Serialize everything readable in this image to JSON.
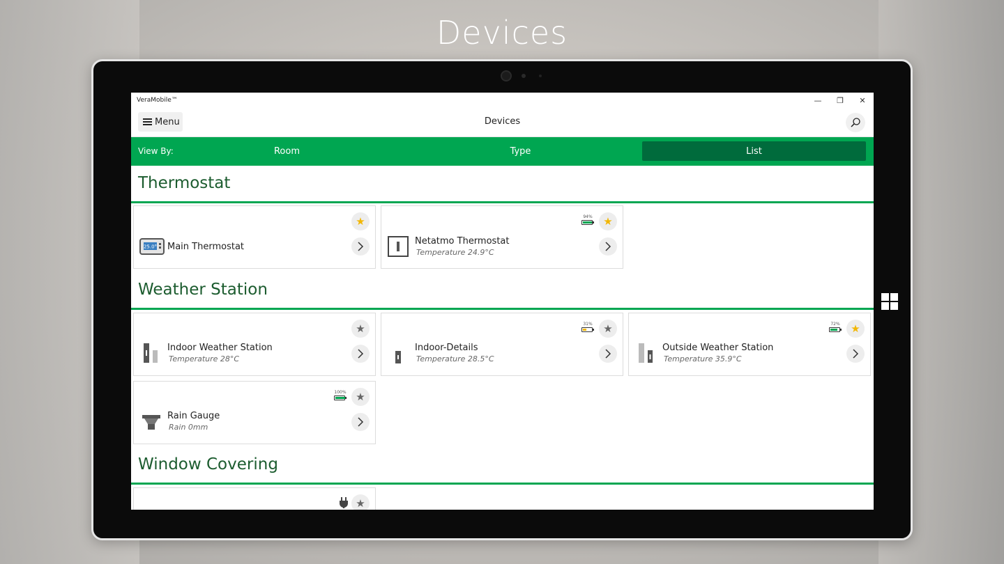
{
  "page_heading": "Devices",
  "window": {
    "title": "VeraMobile™",
    "minimize_glyph": "—",
    "restore_glyph": "❐",
    "close_glyph": "✕"
  },
  "appbar": {
    "menu_label": "Menu",
    "title": "Devices"
  },
  "view_by": {
    "label": "View By:",
    "tabs": [
      {
        "label": "Room",
        "active": false
      },
      {
        "label": "Type",
        "active": false
      },
      {
        "label": "List",
        "active": true
      }
    ]
  },
  "sections": [
    {
      "title": "Thermostat",
      "devices": [
        {
          "name": "Main Thermostat",
          "detail": "",
          "icon": "thermostat-display-icon",
          "display_value": "25.0°",
          "favorite": true,
          "battery": null
        },
        {
          "name": "Netatmo Thermostat",
          "detail": "Temperature 24.9°C",
          "icon": "thermostat-box-icon",
          "favorite": true,
          "battery": {
            "percent": 94,
            "label": "94%"
          }
        }
      ]
    },
    {
      "title": "Weather Station",
      "devices": [
        {
          "name": "Indoor Weather Station",
          "detail": "Temperature 28°C",
          "icon": "weather-station-icon",
          "favorite": false,
          "battery": null
        },
        {
          "name": "Indoor-Details",
          "detail": "Temperature 28.5°C",
          "icon": "weather-module-icon",
          "favorite": false,
          "battery": {
            "percent": 31,
            "label": "31%"
          }
        },
        {
          "name": "Outside Weather Station",
          "detail": "Temperature 35.9°C",
          "icon": "weather-station-icon",
          "favorite": true,
          "battery": {
            "percent": 72,
            "label": "72%"
          }
        },
        {
          "name": "Rain Gauge",
          "detail": "Rain 0mm",
          "icon": "rain-gauge-icon",
          "favorite": false,
          "battery": {
            "percent": 100,
            "label": "100%"
          }
        }
      ]
    },
    {
      "title": "Window Covering",
      "devices": [
        {
          "name": "",
          "detail": "",
          "icon": "",
          "favorite": false,
          "battery": null,
          "powered": true
        }
      ]
    }
  ],
  "colors": {
    "accent_green": "#00a651",
    "active_tab": "#006b3c",
    "section_title": "#1c5c2f",
    "favorite_star": "#f2b705",
    "battery_high": "#00a651",
    "battery_low": "#f2b705"
  }
}
